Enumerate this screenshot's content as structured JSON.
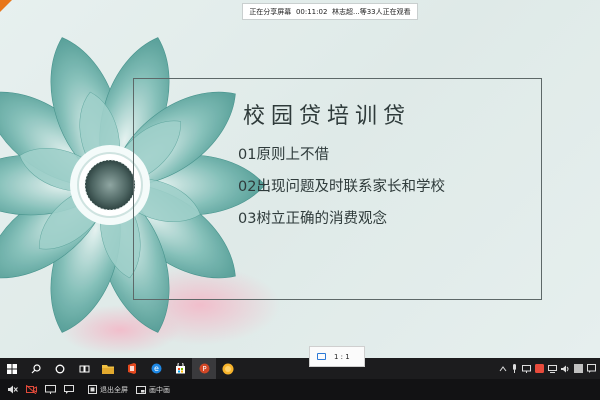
{
  "share_bar": {
    "status": "正在分享屏幕",
    "elapsed": "00:11:02",
    "viewers": "林志超...等33人正在观看"
  },
  "slide": {
    "title": "校园贷培训贷",
    "bullets": [
      "01原则上不借",
      "02出现问题及时联系家长和学校",
      "03树立正确的消费观念"
    ]
  },
  "zoom": {
    "label": "1 : 1"
  },
  "taskbar": {
    "apps": [
      "start-icon",
      "search-icon",
      "cortana-icon",
      "task-view-icon",
      "file-explorer-icon",
      "office-icon",
      "edge-icon",
      "store-icon",
      "powerpoint-icon",
      "yellow-app-icon"
    ],
    "active_app": "powerpoint-icon"
  },
  "controls": {
    "exit_fullscreen": "退出全屏",
    "picture_in_picture": "画中画"
  },
  "colors": {
    "accent_orange": "#e8771b",
    "taskbar": "#1c1c1e",
    "flower_teal": "#6fb3ad"
  }
}
